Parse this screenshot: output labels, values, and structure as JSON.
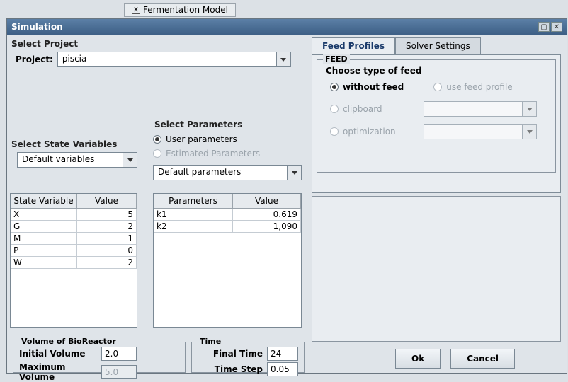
{
  "bg_tab": {
    "label": "Fermentation Model"
  },
  "dialog": {
    "title": "Simulation"
  },
  "project": {
    "section": "Select Project",
    "label": "Project:",
    "value": "piscia"
  },
  "state_vars": {
    "section": "Select State Variables",
    "combo": "Default variables",
    "header_var": "State Variable",
    "header_val": "Value",
    "rows": [
      {
        "v": "X",
        "n": "5"
      },
      {
        "v": "G",
        "n": "2"
      },
      {
        "v": "M",
        "n": "1"
      },
      {
        "v": "P",
        "n": "0"
      },
      {
        "v": "W",
        "n": "2"
      }
    ]
  },
  "params": {
    "section": "Select Parameters",
    "r_user": "User parameters",
    "r_est": "Estimated Parameters",
    "combo": "Default parameters",
    "header_par": "Parameters",
    "header_val": "Value",
    "rows": [
      {
        "p": "k1",
        "n": "0.619"
      },
      {
        "p": "k2",
        "n": "1,090"
      }
    ]
  },
  "volume": {
    "legend": "Volume of BioReactor",
    "l_init": "Initial Volume",
    "v_init": "2.0",
    "l_max": "Maximum Volume",
    "v_max": "5.0"
  },
  "time": {
    "legend": "Time",
    "l_final": "Final Time",
    "v_final": "24",
    "l_step": "Time Step",
    "v_step": "0.05"
  },
  "feed": {
    "tab_profiles": "Feed Profiles",
    "tab_solver": "Solver Settings",
    "legend": "FEED",
    "choose": "Choose type of feed",
    "r_without": "without feed",
    "r_use": "use feed profile",
    "r_clip": "clipboard",
    "r_opt": "optimization"
  },
  "buttons": {
    "ok": "Ok",
    "cancel": "Cancel"
  }
}
